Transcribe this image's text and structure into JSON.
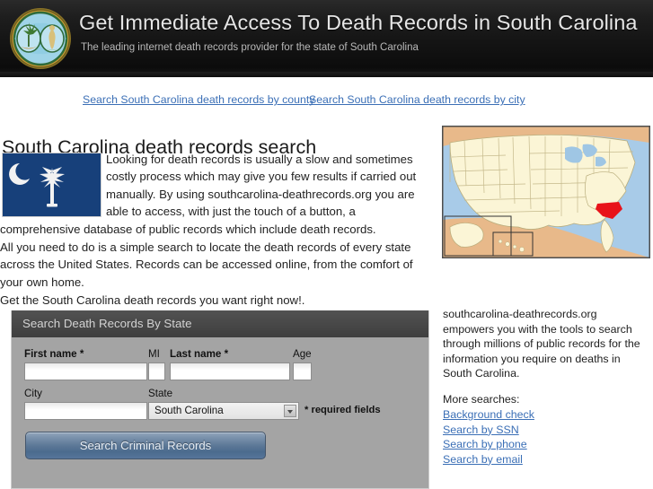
{
  "header": {
    "logo_alt": "South Carolina state seal",
    "title": "Get Immediate Access To Death Records in South Carolina",
    "tagline": "The leading internet death records provider for the state of South Carolina"
  },
  "nav": {
    "county_link": "Search South Carolina death records by county",
    "city_link": "Search South Carolina death records by city"
  },
  "main": {
    "page_title": "South Carolina death records search",
    "flag_alt": "South Carolina state flag",
    "paragraph1": "Looking for death records is usually a slow and sometimes costly process which may give you few results if carried out manually. By using southcarolina-deathrecords.org you are able to access, with just the touch of a button, a comprehensive database of public records which include death records.",
    "paragraph2": "All you need to do is a simple search to locate the death records of every state across the United States. Records can be accessed online, from the comfort of your own home.",
    "paragraph3": "Get the South Carolina death records you want right now!.",
    "map_alt": "Map of the United States with South Carolina highlighted in red"
  },
  "sidebar": {
    "description": "southcarolina-deathrecords.org empowers you with the tools to search through millions of public records for the information you require on deaths in South Carolina.",
    "more_searches_label": "More searches:",
    "links": [
      "Background check",
      "Search by SSN",
      "Search by phone",
      "Search by email"
    ]
  },
  "form": {
    "panel_title": "Search Death Records By State",
    "fields": {
      "first_name_label": "First name *",
      "first_name_value": "",
      "mi_label": "MI",
      "mi_value": "",
      "last_name_label": "Last name *",
      "last_name_value": "",
      "age_label": "Age",
      "age_value": "",
      "city_label": "City",
      "city_value": "",
      "state_label": "State",
      "state_value": "South Carolina"
    },
    "required_note": "* required fields",
    "submit_label": "Search Criminal Records"
  },
  "colors": {
    "header_bg": "#141414",
    "link": "#3b6fb6",
    "panel_header_bg": "#484848",
    "panel_body_bg": "#a4a4a4",
    "button_blue": "#5b7796",
    "highlight_state": "#e8131a",
    "flag_blue": "#17407a"
  }
}
